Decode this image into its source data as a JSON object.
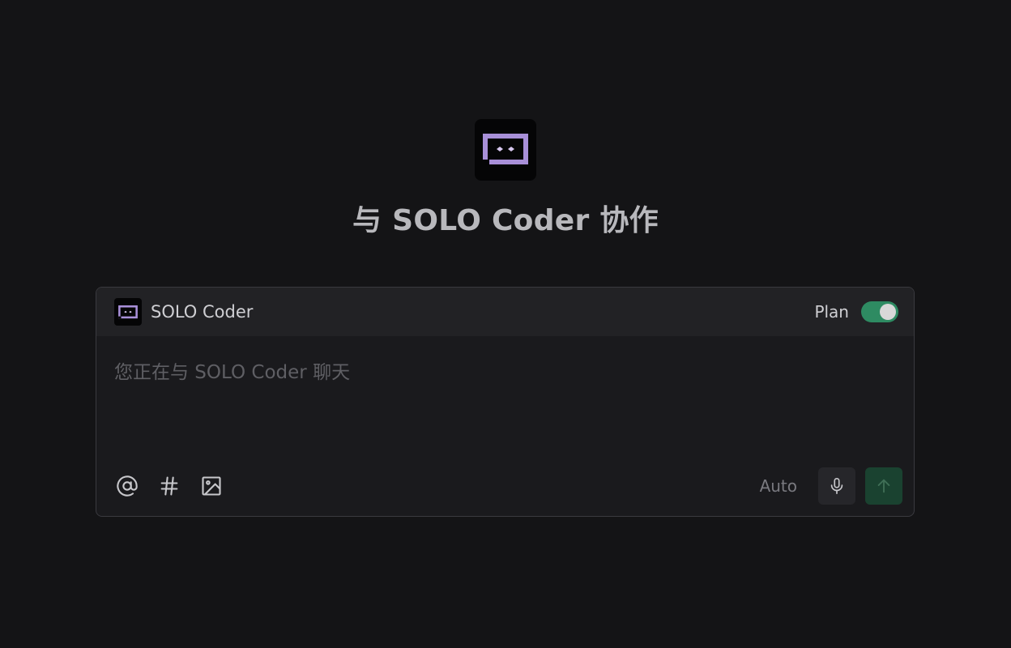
{
  "hero": {
    "title": "与 SOLO Coder 协作",
    "logo_icon": "solo-bot-icon"
  },
  "card": {
    "agent": {
      "name": "SOLO Coder",
      "icon": "solo-bot-icon"
    },
    "plan": {
      "label": "Plan",
      "enabled": true
    },
    "input": {
      "placeholder": "您正在与 SOLO Coder 聊天",
      "value": ""
    },
    "toolbar": {
      "tools": [
        {
          "icon": "at-icon"
        },
        {
          "icon": "hash-icon"
        },
        {
          "icon": "image-icon"
        }
      ],
      "mode_label": "Auto",
      "mic_icon": "microphone-icon",
      "send_icon": "arrow-up-icon"
    }
  },
  "colors": {
    "background": "#141416",
    "card": "#1a1a1d",
    "accent_green": "#2e8b62",
    "logo_purple": "#a88fd8"
  }
}
